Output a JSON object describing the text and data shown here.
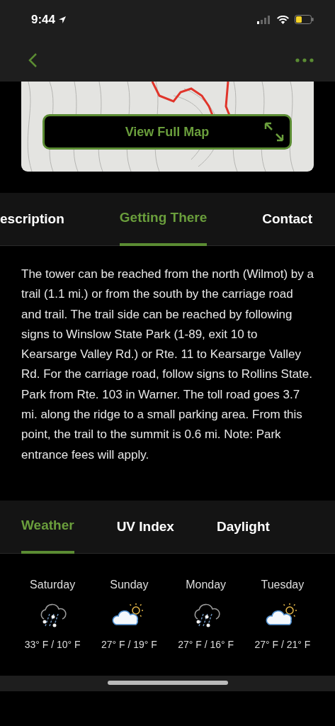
{
  "status_bar": {
    "time": "9:44"
  },
  "map": {
    "button": "View Full Map"
  },
  "tabs": [
    {
      "label": "escription",
      "selected": false
    },
    {
      "label": "Getting There",
      "selected": true
    },
    {
      "label": "Contact",
      "selected": false
    }
  ],
  "description": "The tower can be reached from the north (Wilmot) by a trail (1.1 mi.) or from the south by the carriage road and trail. The trail side can be reached by following signs to Winslow State Park (1-89, exit 10 to Kearsarge Valley Rd.) or Rte. 11 to Kearsarge Valley Rd. For the carriage road, follow signs to Rollins State. Park from Rte. 103 in Warner. The toll road goes 3.7 mi. along the ridge to a small parking area. From this point, the trail to the summit is 0.6 mi. Note: Park entrance fees will apply.",
  "weather_tabs": [
    {
      "label": "Weather",
      "selected": true
    },
    {
      "label": "UV Index",
      "selected": false
    },
    {
      "label": "Daylight",
      "selected": false
    }
  ],
  "forecast": [
    {
      "day": "Saturday",
      "kind": "snow",
      "temps": "33° F / 10° F"
    },
    {
      "day": "Sunday",
      "kind": "partly-cloudy",
      "temps": "27° F / 19° F"
    },
    {
      "day": "Monday",
      "kind": "snow",
      "temps": "27° F / 16° F"
    },
    {
      "day": "Tuesday",
      "kind": "partly-cloudy",
      "temps": "27° F / 21° F"
    }
  ]
}
